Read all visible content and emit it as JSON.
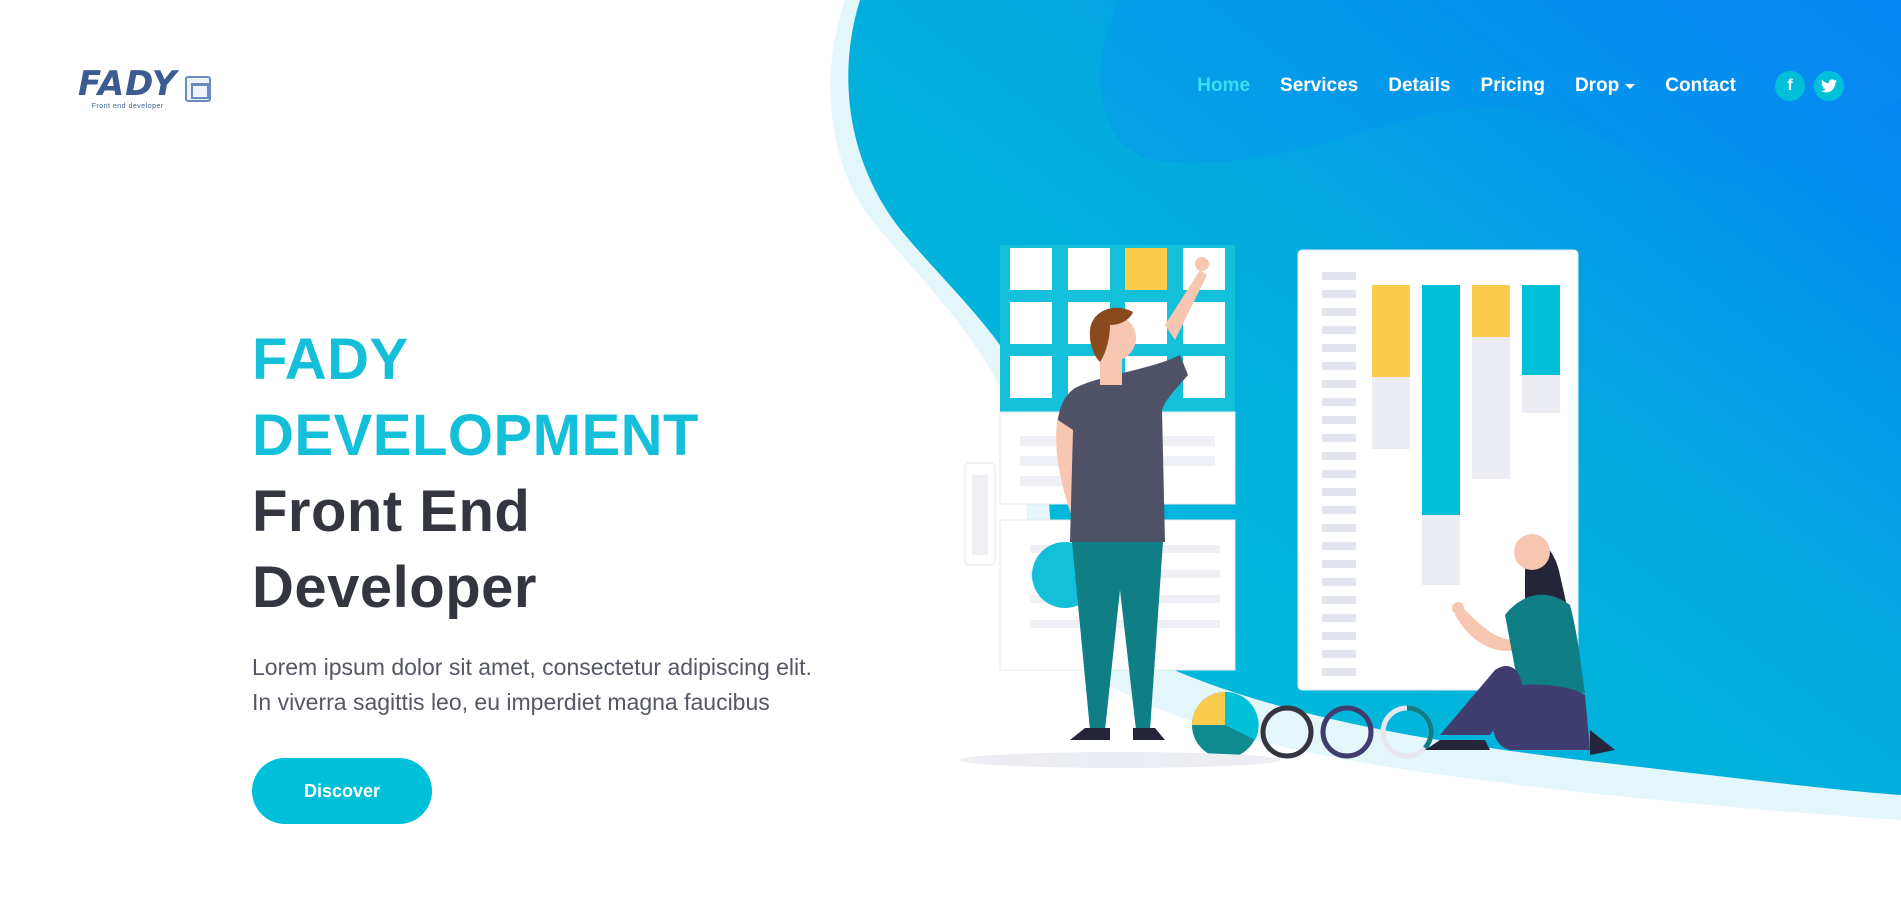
{
  "brand": {
    "logo_word": "FADY",
    "logo_sub": "Front end developer"
  },
  "nav": {
    "items": [
      {
        "label": "Home",
        "active": true
      },
      {
        "label": "Services"
      },
      {
        "label": "Details"
      },
      {
        "label": "Pricing"
      },
      {
        "label": "Drop",
        "dropdown": true
      },
      {
        "label": "Contact"
      }
    ],
    "socials": [
      {
        "icon": "facebook-icon",
        "glyph": "f"
      },
      {
        "icon": "twitter-icon",
        "glyph": "t"
      }
    ]
  },
  "hero": {
    "line1": "FADY",
    "line2": "DEVELOPMENT",
    "line3": "Front End",
    "line4": "Developer",
    "lede1": "Lorem ipsum dolor sit amet, consectetur adipiscing elit.",
    "lede2": "In viverra sagittis leo, eu imperdiet magna faucibus",
    "cta": "Discover"
  },
  "colors": {
    "accent": "#00bfd8",
    "gradient_start": "#00c2d6",
    "gradient_end": "#0581f7",
    "heading_dark": "#33363f",
    "nav_active": "#34e0f1"
  }
}
